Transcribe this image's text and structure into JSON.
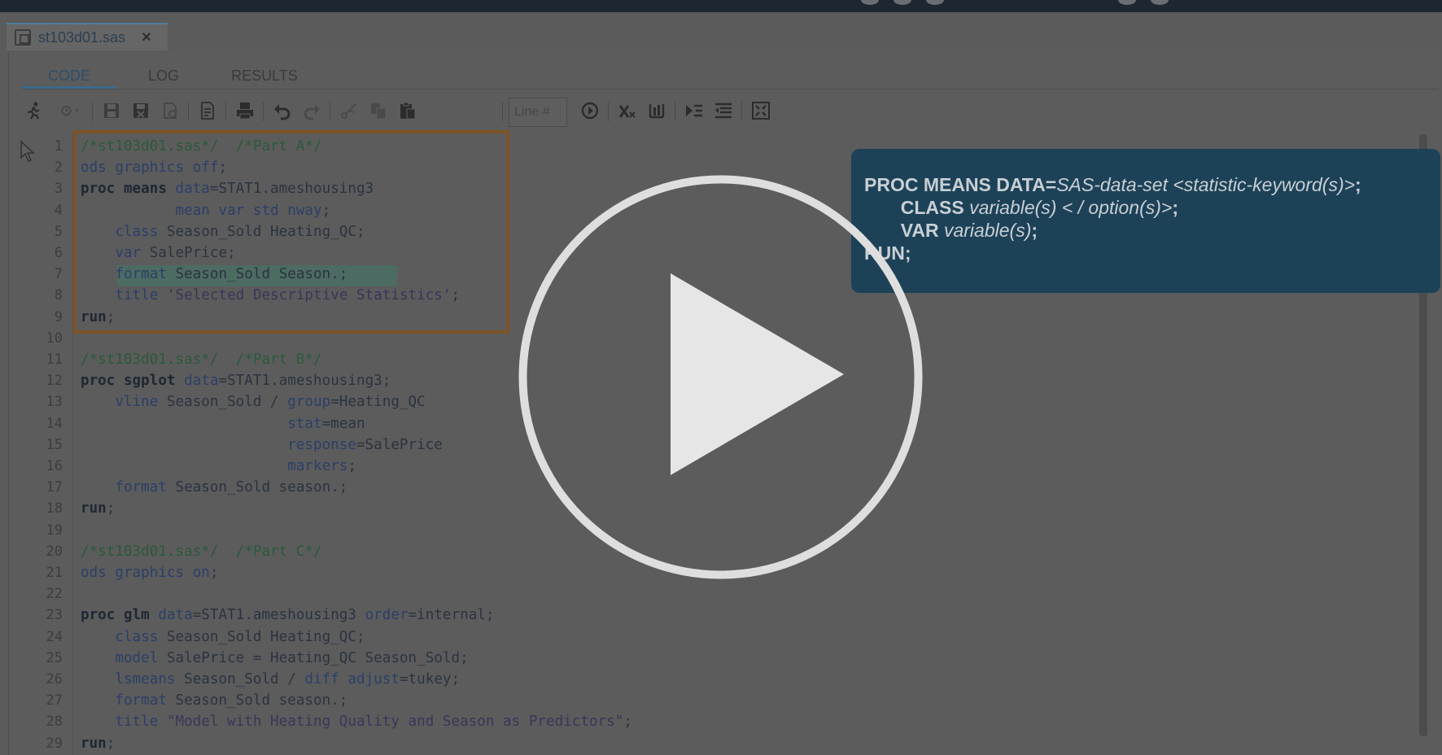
{
  "file_tab": {
    "name": "st103d01.sas",
    "close": "×"
  },
  "subtabs": [
    "CODE",
    "LOG",
    "RESULTS"
  ],
  "toolbar": {
    "line_placeholder": "Line #",
    "icons": [
      "run-icon",
      "history-icon",
      "save-icon",
      "save-as-icon",
      "save-copy-icon",
      "document-icon",
      "print-icon",
      "undo-icon",
      "redo-icon",
      "cut-icon",
      "copy-icon",
      "paste-icon",
      "go-to-line-icon",
      "clear-icon",
      "format-code-icon",
      "indent-icon",
      "outdent-icon",
      "maximize-icon"
    ]
  },
  "code": {
    "line_numbers": [
      "1",
      "2",
      "3",
      "4",
      "5",
      "6",
      "7",
      "8",
      "9",
      "10",
      "11",
      "12",
      "13",
      "14",
      "15",
      "16",
      "17",
      "18",
      "19",
      "20",
      "21",
      "22",
      "23",
      "24",
      "25",
      "26",
      "27",
      "28",
      "29"
    ],
    "lines": [
      [
        {
          "t": "/*st103d01.sas*/  /*Part A*/",
          "c": "com"
        }
      ],
      [
        {
          "t": "ods graphics ",
          "c": "opt"
        },
        {
          "t": "off",
          "c": "opt"
        },
        {
          "t": ";",
          "c": "plain"
        }
      ],
      [
        {
          "t": "proc means",
          "c": "kw"
        },
        {
          "t": " data",
          "c": "opt"
        },
        {
          "t": "=STAT1.ameshousing3",
          "c": "plain"
        }
      ],
      [
        {
          "t": "           mean var std nway",
          "c": "opt"
        },
        {
          "t": ";",
          "c": "plain"
        }
      ],
      [
        {
          "t": "    class",
          "c": "opt"
        },
        {
          "t": " Season_Sold Heating_QC;",
          "c": "plain"
        }
      ],
      [
        {
          "t": "    var",
          "c": "opt"
        },
        {
          "t": " SalePrice;",
          "c": "plain"
        }
      ],
      [
        {
          "t": "    format",
          "c": "opt"
        },
        {
          "t": " Season_Sold Season.;",
          "c": "plain"
        }
      ],
      [
        {
          "t": "    title",
          "c": "opt"
        },
        {
          "t": " 'Selected Descriptive Statistics'",
          "c": "str"
        },
        {
          "t": ";",
          "c": "plain"
        }
      ],
      [
        {
          "t": "run",
          "c": "kw"
        },
        {
          "t": ";",
          "c": "plain"
        }
      ],
      [],
      [
        {
          "t": "/*st103d01.sas*/  /*Part B*/",
          "c": "com"
        }
      ],
      [
        {
          "t": "proc sgplot",
          "c": "kw"
        },
        {
          "t": " data",
          "c": "opt"
        },
        {
          "t": "=STAT1.ameshousing3;",
          "c": "plain"
        }
      ],
      [
        {
          "t": "    vline",
          "c": "opt"
        },
        {
          "t": " Season_Sold / ",
          "c": "plain"
        },
        {
          "t": "group",
          "c": "opt"
        },
        {
          "t": "=Heating_QC",
          "c": "plain"
        }
      ],
      [
        {
          "t": "                        stat",
          "c": "opt"
        },
        {
          "t": "=mean",
          "c": "plain"
        }
      ],
      [
        {
          "t": "                        response",
          "c": "opt"
        },
        {
          "t": "=SalePrice",
          "c": "plain"
        }
      ],
      [
        {
          "t": "                        markers",
          "c": "opt"
        },
        {
          "t": ";",
          "c": "plain"
        }
      ],
      [
        {
          "t": "    format",
          "c": "opt"
        },
        {
          "t": " Season_Sold season.;",
          "c": "plain"
        }
      ],
      [
        {
          "t": "run",
          "c": "kw"
        },
        {
          "t": ";",
          "c": "plain"
        }
      ],
      [],
      [
        {
          "t": "/*st103d01.sas*/  /*Part C*/",
          "c": "com"
        }
      ],
      [
        {
          "t": "ods graphics ",
          "c": "opt"
        },
        {
          "t": "on",
          "c": "opt"
        },
        {
          "t": ";",
          "c": "plain"
        }
      ],
      [],
      [
        {
          "t": "proc glm",
          "c": "kw"
        },
        {
          "t": " data",
          "c": "opt"
        },
        {
          "t": "=STAT1.ameshousing3 ",
          "c": "plain"
        },
        {
          "t": "order",
          "c": "opt"
        },
        {
          "t": "=internal;",
          "c": "plain"
        }
      ],
      [
        {
          "t": "    class",
          "c": "opt"
        },
        {
          "t": " Season_Sold Heating_QC;",
          "c": "plain"
        }
      ],
      [
        {
          "t": "    model",
          "c": "opt"
        },
        {
          "t": " SalePrice = Heating_QC Season_Sold;",
          "c": "plain"
        }
      ],
      [
        {
          "t": "    lsmeans",
          "c": "opt"
        },
        {
          "t": " Season_Sold / ",
          "c": "plain"
        },
        {
          "t": "diff adjust",
          "c": "opt"
        },
        {
          "t": "=tukey;",
          "c": "plain"
        }
      ],
      [
        {
          "t": "    format",
          "c": "opt"
        },
        {
          "t": " Season_Sold season.;",
          "c": "plain"
        }
      ],
      [
        {
          "t": "    title",
          "c": "opt"
        },
        {
          "t": " \"Model with Heating Quality and Season as Predictors\"",
          "c": "str"
        },
        {
          "t": ";",
          "c": "plain"
        }
      ],
      [
        {
          "t": "run",
          "c": "kw"
        },
        {
          "t": ";",
          "c": "plain"
        }
      ]
    ]
  },
  "syntax_box": {
    "line1": [
      {
        "t": "PROC MEANS DATA=",
        "s": "b"
      },
      {
        "t": "SAS-data-set <statistic-keyword(s)>",
        "s": "i"
      },
      {
        "t": ";",
        "s": "b"
      }
    ],
    "line2": [
      {
        "t": "       CLASS ",
        "s": "b"
      },
      {
        "t": "variable(s) < / option(s)>",
        "s": "i"
      },
      {
        "t": ";",
        "s": "b"
      }
    ],
    "line3": [
      {
        "t": "       VAR ",
        "s": "b"
      },
      {
        "t": "variable(s)",
        "s": "i"
      },
      {
        "t": ";",
        "s": "b"
      }
    ],
    "line4": [
      {
        "t": "RUN;",
        "s": "b"
      }
    ]
  },
  "colors": {
    "overlay": "#5a5a5a",
    "syntax_box": "#1d4258",
    "highlight_border": "#7d5326",
    "highlight_line": "#4c6b62",
    "play": "#e0e0e0"
  }
}
